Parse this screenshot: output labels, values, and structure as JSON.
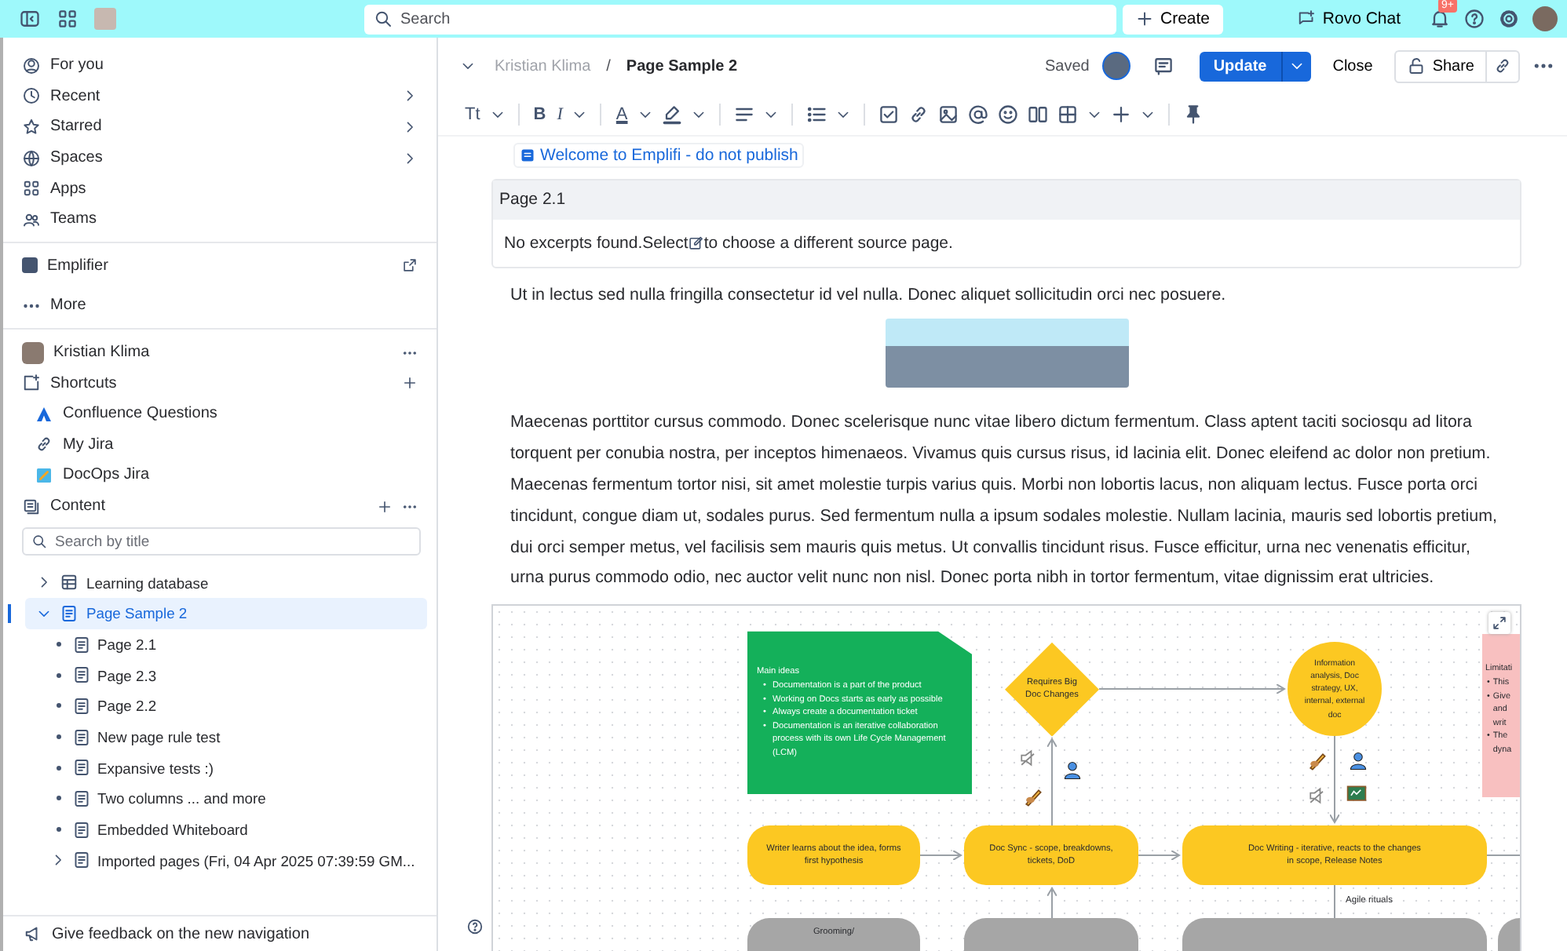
{
  "topbar": {
    "search": {
      "placeholder": "Search"
    },
    "create": "Create",
    "rovo": "Rovo Chat",
    "notification_badge": "9+"
  },
  "sidebar": {
    "nav": [
      {
        "label": "For you",
        "has_submenu": false
      },
      {
        "label": "Recent",
        "has_submenu": true
      },
      {
        "label": "Starred",
        "has_submenu": true
      },
      {
        "label": "Spaces",
        "has_submenu": true
      },
      {
        "label": "Apps",
        "has_submenu": false
      },
      {
        "label": "Teams",
        "has_submenu": false
      }
    ],
    "app": "Emplifier",
    "more": "More",
    "user": "Kristian Klima",
    "shortcuts": {
      "title": "Shortcuts",
      "items": [
        "Confluence Questions",
        "My Jira",
        "DocOps Jira"
      ]
    },
    "content": {
      "title": "Content",
      "search": {
        "placeholder": "Search by title"
      },
      "tree": [
        {
          "label": "Learning database",
          "expanded": false,
          "selected": false
        },
        {
          "label": "Page Sample 2",
          "expanded": true,
          "selected": true,
          "children": [
            {
              "label": "Page 2.1"
            },
            {
              "label": "Page 2.3"
            },
            {
              "label": "Page 2.2"
            },
            {
              "label": "New page rule test"
            },
            {
              "label": "Expansive tests :)"
            },
            {
              "label": "Two columns ... and more"
            },
            {
              "label": "Embedded Whiteboard"
            },
            {
              "label": "Imported pages (Fri, 04 Apr 2025 07:39:59 GM...",
              "expanded": false
            }
          ]
        }
      ]
    },
    "feedback": "Give feedback on the new navigation"
  },
  "header": {
    "breadcrumb": [
      "Kristian Klima",
      "Page Sample 2"
    ],
    "separator": "/",
    "status": "Saved",
    "update": "Update",
    "close": "Close",
    "share": "Share"
  },
  "toolbar": {
    "text_style": "Tt",
    "bold": "B",
    "italic": "I",
    "text_color": "A"
  },
  "page": {
    "link": "Welcome to Emplifi - do not publish",
    "excerpt": {
      "title": "Page 2.1",
      "before": "No excerpts found.Select",
      "after": "to choose a different source page."
    },
    "paragraphs": [
      "Ut in lectus sed nulla fringilla consectetur id vel nulla. Donec aliquet sollicitudin orci nec posuere.",
      "Maecenas porttitor cursus commodo. Donec scelerisque nunc vitae libero dictum fermentum. Class aptent taciti sociosqu ad litora torquent per conubia nostra, per inceptos himenaeos. Vivamus quis cursus risus, id lacinia elit. Donec eleifend ac dolor non pretium. Maecenas fermentum tortor nisi, sit amet molestie turpis varius quis. Morbi non lobortis lacus, non aliquam lectus. Fusce porta orci tincidunt, congue diam ut, sodales purus. Sed fermentum nulla a ipsum sodales molestie. Nullam lacinia, mauris sed lobortis pretium, dui orci semper metus, vel facilisis sem mauris quis metus. Ut convallis tincidunt risus. Fusce efficitur, urna nec venenatis efficitur, urna purus commodo odio, nec auctor velit nunc non nisl. Donec porta nibh in tortor fermentum, vitae dignissim erat ultricies."
    ]
  },
  "whiteboard": {
    "marker": "•",
    "note": {
      "title": "Main ideas",
      "items": [
        "Documentation is a part of the product",
        "Working on Docs starts as early as possible",
        "Always create a documentation ticket",
        "Documentation is an iterative collaboration process with its own Life Cycle Management (LCM)"
      ]
    },
    "decision": "Requires Big Doc Changes",
    "circle": "Information analysis, Doc strategy, UX, internal, external doc",
    "side_note": {
      "title": "Limitati",
      "items": [
        [
          "This"
        ],
        [
          "Give",
          "and",
          "writ"
        ],
        [
          "The",
          "dyna"
        ]
      ]
    },
    "steps": [
      "Writer learns about the idea, forms first hypothesis",
      "Doc Sync - scope, breakdowns, tickets, DoD",
      "Doc Writing - iterative, reacts to the changes in scope, Release Notes"
    ],
    "edge_label": "Agile rituals",
    "lower_step": "Grooming/"
  }
}
